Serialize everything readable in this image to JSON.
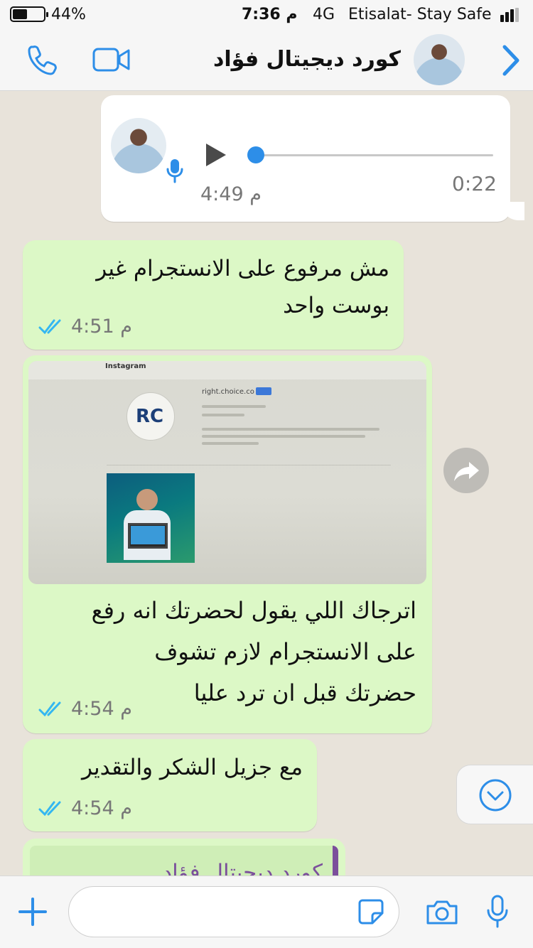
{
  "status_bar": {
    "battery": "44%",
    "time": "7:36 م",
    "network": "4G",
    "carrier": "Etisalat- Stay Safe"
  },
  "header": {
    "contact_name": "كورد ديجيتال فؤاد"
  },
  "messages": [
    {
      "type": "voice",
      "direction": "incoming",
      "duration": "0:22",
      "time": "4:49 م"
    },
    {
      "type": "text",
      "direction": "outgoing",
      "lines": [
        "مش مرفوع على الانستجرام غير",
        "بوست واحد"
      ],
      "time": "4:51 م",
      "status": "read"
    },
    {
      "type": "image",
      "direction": "outgoing",
      "image": {
        "site": "Instagram",
        "handle": "right.choice.co",
        "logo": "RC"
      },
      "caption_lines": [
        "اترجاك اللي يقول لحضرتك انه رفع",
        "على الانستجرام لازم تشوف",
        "حضرتك قبل ان ترد عليا"
      ],
      "time": "4:54 م",
      "status": "read"
    },
    {
      "type": "text",
      "direction": "outgoing",
      "lines": [
        "مع جزيل الشكر والتقدير"
      ],
      "time": "4:54 م",
      "status": "read"
    },
    {
      "type": "quoted",
      "direction": "outgoing",
      "quoted_name": "كورد ديجيتال فؤاد"
    }
  ],
  "input": {
    "placeholder": ""
  },
  "colors": {
    "accent": "#2d8ee8",
    "outgoing_bubble": "#dcf8c6",
    "incoming_bubble": "#ffffff",
    "quote_bar": "#7b4f9b",
    "read_ticks": "#34b7f1"
  },
  "icons": [
    "phone-icon",
    "video-icon",
    "chevron-right-icon",
    "play-icon",
    "mic-icon",
    "forward-icon",
    "chevron-down-icon",
    "plus-icon",
    "sticker-icon",
    "camera-icon"
  ]
}
